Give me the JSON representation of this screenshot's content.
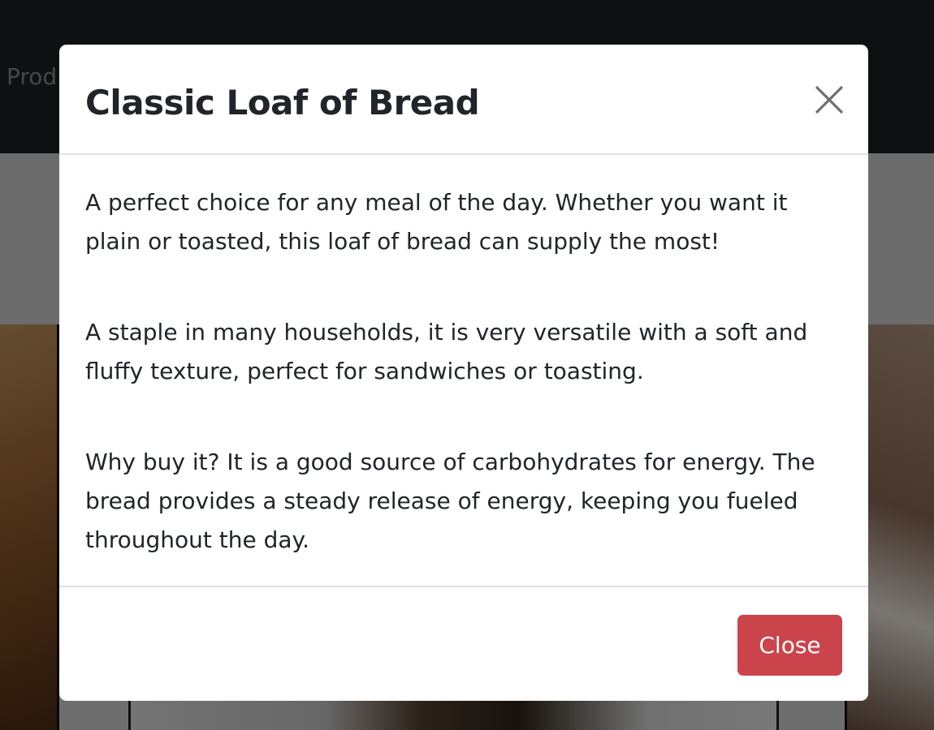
{
  "background_page": {
    "nav_link_partial": "Prod"
  },
  "modal": {
    "title": "Classic Loaf of Bread",
    "close_icon": "close-icon",
    "paragraphs": [
      "A perfect choice for any meal of the day. Whether you want it plain or toasted, this loaf of bread can supply the most!",
      "A staple in many households, it is very versatile with a soft and fluffy texture, perfect for sandwiches or toasting.",
      "Why buy it? It is a good source of carbohydrates for energy. The bread provides a steady release of energy, keeping you fueled throughout the day."
    ],
    "close_button_label": "Close"
  },
  "colors": {
    "navbar_bg": "#1d2024",
    "backdrop": "rgba(0,0,0,0.5)",
    "modal_bg": "#ffffff",
    "text": "#212529",
    "divider": "#dee2e6",
    "close_button_bg": "#cc444b",
    "close_button_text": "#ffffff"
  }
}
